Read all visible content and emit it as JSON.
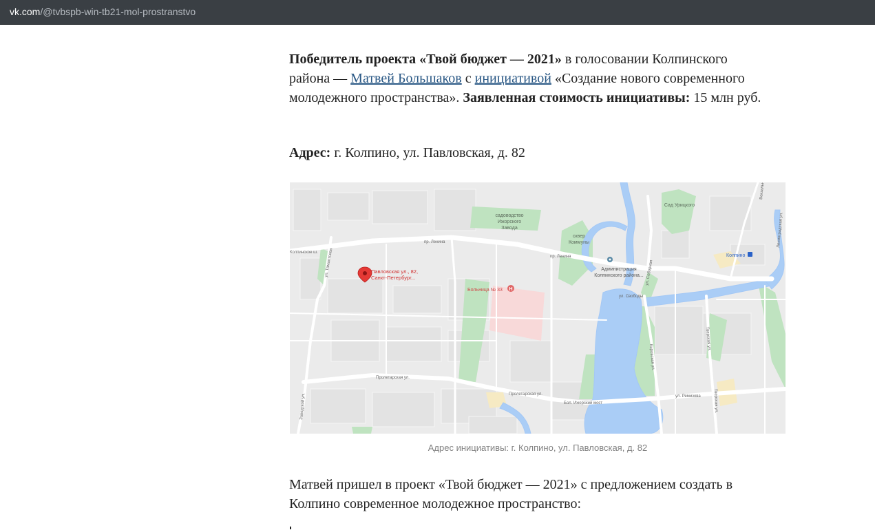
{
  "browser": {
    "url_host": "vk.com",
    "url_path": "/@tvbspb-win-tb21-mol-prostranstvo"
  },
  "article": {
    "p1": {
      "bold1": "Победитель проекта «Твой бюджет — 2021»",
      "text1": " в голосовании Колпинского района — ",
      "link1": "Матвей Большаков",
      "text2": " с ",
      "link2": "инициативой",
      "text3": " «Создание нового современного молодежного пространства». ",
      "bold2": "Заявленная стоимость инициативы:",
      "text4": " 15 млн руб."
    },
    "address": {
      "label": "Адрес:",
      "value": " г. Колпино, ул. Павловская, д. 82"
    },
    "map": {
      "pin_line1": "Павловская ул., 82,",
      "pin_line2": "Санкт-Петербург...",
      "hospital": "Больница № 33",
      "sad1": "садоводство",
      "sad2": "Ижорского",
      "sad3": "Завода",
      "sq1": "сквер",
      "sq2": "Коммуны",
      "adm1": "Администрация",
      "adm2": "Колпинского района...",
      "sad_urick": "Сад Урицкого",
      "kolpino": "Колпино",
      "pr_lenina_1": "пр. Ленина",
      "pr_lenina_2": "пр. Ленина",
      "kolp_shosse": "Колпинское ш.",
      "ul_tamaptseva": "ул. Тамаптсева",
      "zaoryb": "Заводской ул.",
      "proletarskaya_1": "Пролетарская ул.",
      "proletarskaya_2": "Пролетарская ул.",
      "bol_izh_most": "Бол. Ижорский мост",
      "ul_remizova": "ул. Ремизова",
      "ul_svobody": "ул. Свободы",
      "ul_soborn": "ул. Соборная",
      "kirovskaya": "Кировская ул.",
      "tverskaya_1": "Тверская ул.",
      "tverskaya_2": "Тверская ул.",
      "lenin_right": "Ленинградская ул.",
      "vokzal": "Вокзальная ул."
    },
    "caption": "Адрес инициативы: г. Колпино, ул. Павловская, д. 82",
    "p3": "Матвей пришел в проект «Твой бюджет — 2021» с предложением создать в Колпино современное молодежное пространство:"
  }
}
